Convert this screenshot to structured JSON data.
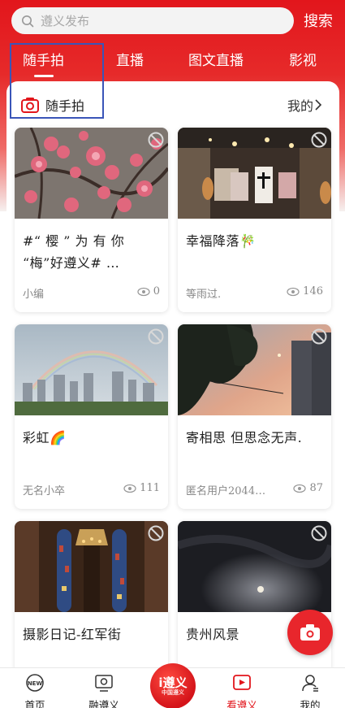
{
  "search": {
    "placeholder": "遵义发布",
    "button_label": "搜索"
  },
  "tabs": [
    {
      "label": "随手拍",
      "active": true
    },
    {
      "label": "直播"
    },
    {
      "label": "图文直播"
    },
    {
      "label": "影视"
    }
  ],
  "section": {
    "title": "随手拍",
    "mine_label": "我的"
  },
  "posts": [
    {
      "title": "#“ 樱 ” 为 有 你 “梅”好遵义# …",
      "author": "小编",
      "views": "0",
      "image": "plum-blossom-photo"
    },
    {
      "title": "幸福降落🎋",
      "author": "等雨过.",
      "views": "146",
      "image": "guitar-bar-photo"
    },
    {
      "title": "彩虹🌈",
      "author": "无名小卒",
      "views": "111",
      "image": "rainbow-city-photo"
    },
    {
      "title": "寄相思 但思念无声.",
      "author": "匿名用户2044…",
      "views": "87",
      "image": "sunset-tree-photo"
    },
    {
      "title": "摄影日记-红军街",
      "author": "",
      "views": "",
      "image": "church-window-photo"
    },
    {
      "title": "贵州风景",
      "author": "",
      "views": "",
      "image": "night-moon-photo"
    }
  ],
  "nav": {
    "items": [
      {
        "label": "首页",
        "icon": "home-new-icon"
      },
      {
        "label": "融遵义",
        "icon": "tv-icon"
      },
      {
        "label": "看遵义",
        "icon": "video-icon",
        "active": true
      },
      {
        "label": "我的",
        "icon": "profile-icon"
      }
    ],
    "center": {
      "text": "i遵义",
      "sub": "中国遵义"
    }
  },
  "colors": {
    "brand_red": "#e2161c",
    "highlight_box": "#3a55b8"
  }
}
